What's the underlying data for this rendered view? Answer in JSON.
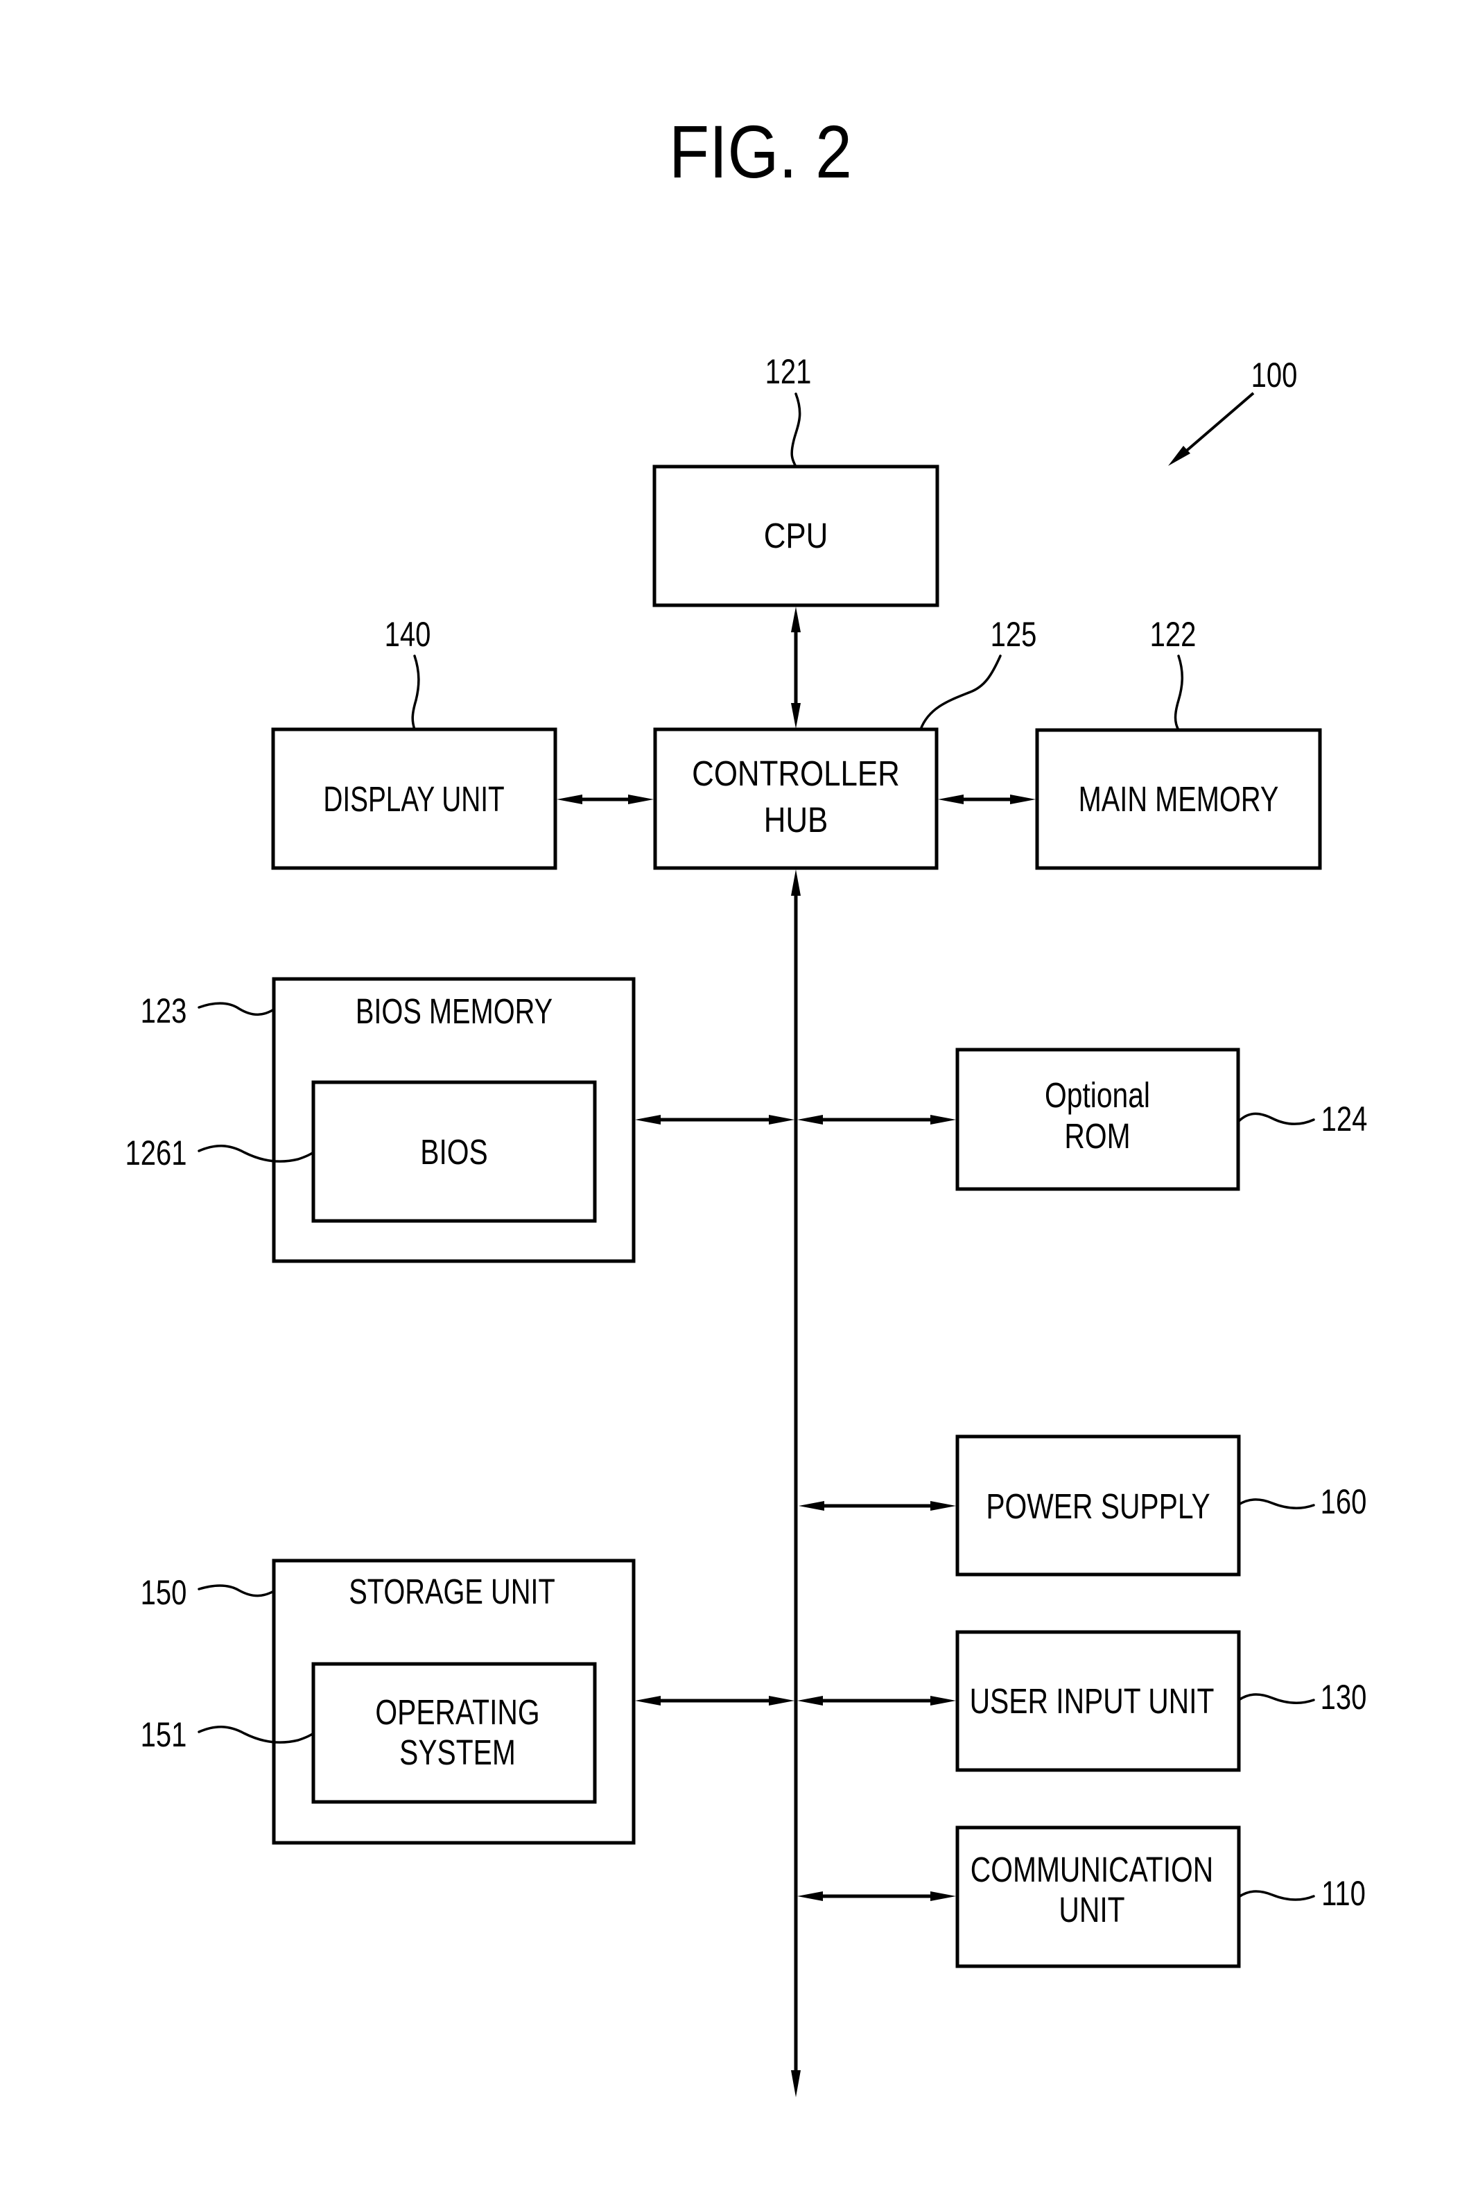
{
  "figure": {
    "title": "FIG. 2",
    "system_ref": "100"
  },
  "blocks": {
    "cpu": {
      "label": "CPU",
      "ref": "121"
    },
    "controller_hub": {
      "label_line1": "CONTROLLER",
      "label_line2": "HUB",
      "ref": "125"
    },
    "display_unit": {
      "label": "DISPLAY UNIT",
      "ref": "140"
    },
    "main_memory": {
      "label": "MAIN MEMORY",
      "ref": "122"
    },
    "bios_memory": {
      "label": "BIOS MEMORY",
      "ref": "123"
    },
    "bios": {
      "label": "BIOS",
      "ref": "1261"
    },
    "optional_rom": {
      "label_line1": "Optional",
      "label_line2": "ROM",
      "ref": "124"
    },
    "power_supply": {
      "label": "POWER SUPPLY",
      "ref": "160"
    },
    "storage_unit": {
      "label": "STORAGE UNIT",
      "ref": "150"
    },
    "operating_system": {
      "label_line1": "OPERATING",
      "label_line2": "SYSTEM",
      "ref": "151"
    },
    "user_input_unit": {
      "label": "USER INPUT UNIT",
      "ref": "130"
    },
    "communication_unit": {
      "label_line1": "COMMUNICATION",
      "label_line2": "UNIT",
      "ref": "110"
    }
  },
  "connections": [
    {
      "from": "CPU",
      "to": "CONTROLLER HUB",
      "direction": "bidirectional"
    },
    {
      "from": "DISPLAY UNIT",
      "to": "CONTROLLER HUB",
      "direction": "bidirectional"
    },
    {
      "from": "CONTROLLER HUB",
      "to": "MAIN MEMORY",
      "direction": "bidirectional"
    },
    {
      "from": "CONTROLLER HUB",
      "to": "BUS",
      "direction": "bidirectional"
    },
    {
      "from": "BIOS MEMORY",
      "to": "BUS",
      "direction": "bidirectional"
    },
    {
      "from": "BUS",
      "to": "Optional ROM",
      "direction": "bidirectional"
    },
    {
      "from": "BUS",
      "to": "POWER SUPPLY",
      "direction": "bidirectional"
    },
    {
      "from": "STORAGE UNIT",
      "to": "BUS",
      "direction": "bidirectional"
    },
    {
      "from": "BUS",
      "to": "USER INPUT UNIT",
      "direction": "bidirectional"
    },
    {
      "from": "BUS",
      "to": "COMMUNICATION UNIT",
      "direction": "bidirectional"
    }
  ]
}
